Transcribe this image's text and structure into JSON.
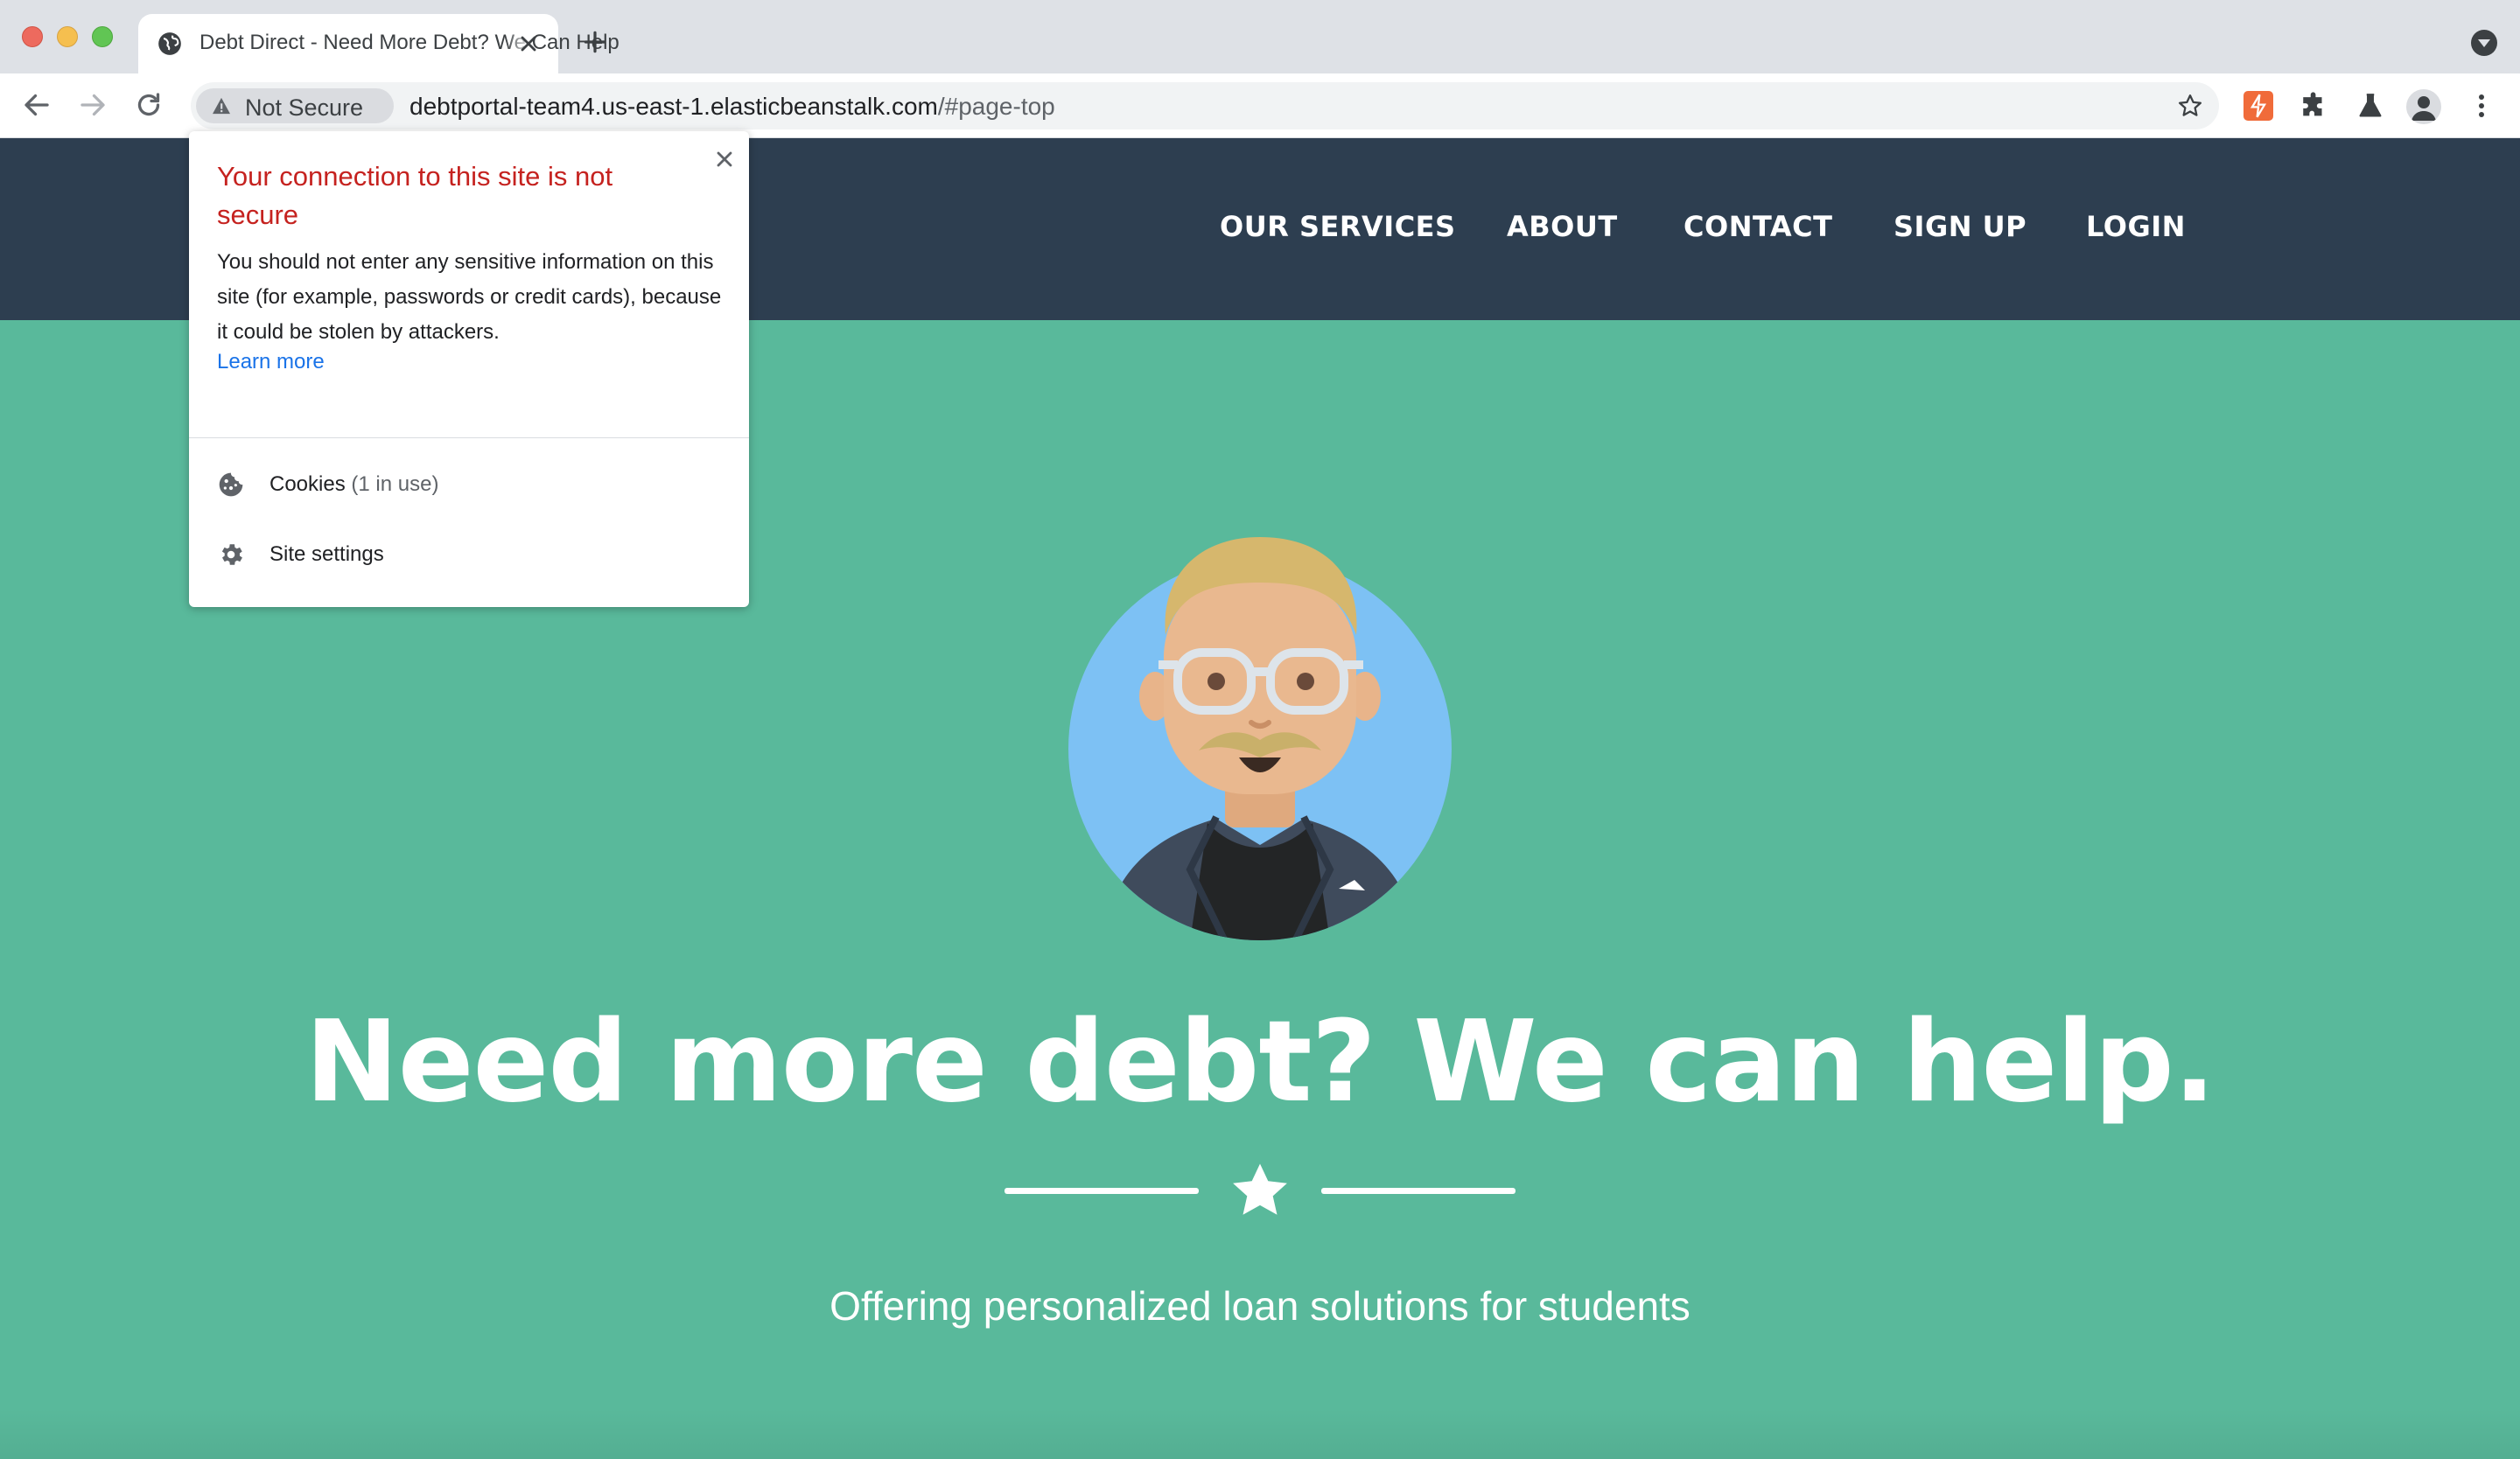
{
  "browser": {
    "tab": {
      "title": "Debt Direct - Need More Debt? We Can Help"
    },
    "security_chip_label": "Not Secure",
    "url": {
      "host": "debtportal-team4.us-east-1.elasticbeanstalk.com",
      "path": "/#page-top"
    }
  },
  "site_nav": {
    "links": [
      "OUR SERVICES",
      "ABOUT",
      "CONTACT",
      "SIGN UP",
      "LOGIN"
    ]
  },
  "hero": {
    "headline": "Need more debt? We can help.",
    "subheading": "Offering personalized loan solutions for students"
  },
  "security_popup": {
    "title": "Your connection to this site is not secure",
    "body": "You should not enter any sensitive information on this site (for example, passwords or credit cards), because it could be stolen by attackers.",
    "learn_more": "Learn more",
    "cookies_label": "Cookies",
    "cookies_usage": "(1 in use)",
    "site_settings_label": "Site settings"
  },
  "colors": {
    "nav_background": "#2d3e50",
    "hero_background": "#59b99b",
    "warning_title": "#c5221f",
    "link": "#1a73e8"
  },
  "icons": [
    "globe-icon",
    "close-icon",
    "plus-icon",
    "back-arrow-icon",
    "forward-arrow-icon",
    "reload-icon",
    "warning-icon",
    "star-bookmark-icon",
    "extensions-puzzle-icon",
    "labs-flask-icon",
    "profile-icon",
    "more-menu-icon",
    "cookie-icon",
    "gear-icon",
    "star-icon"
  ]
}
